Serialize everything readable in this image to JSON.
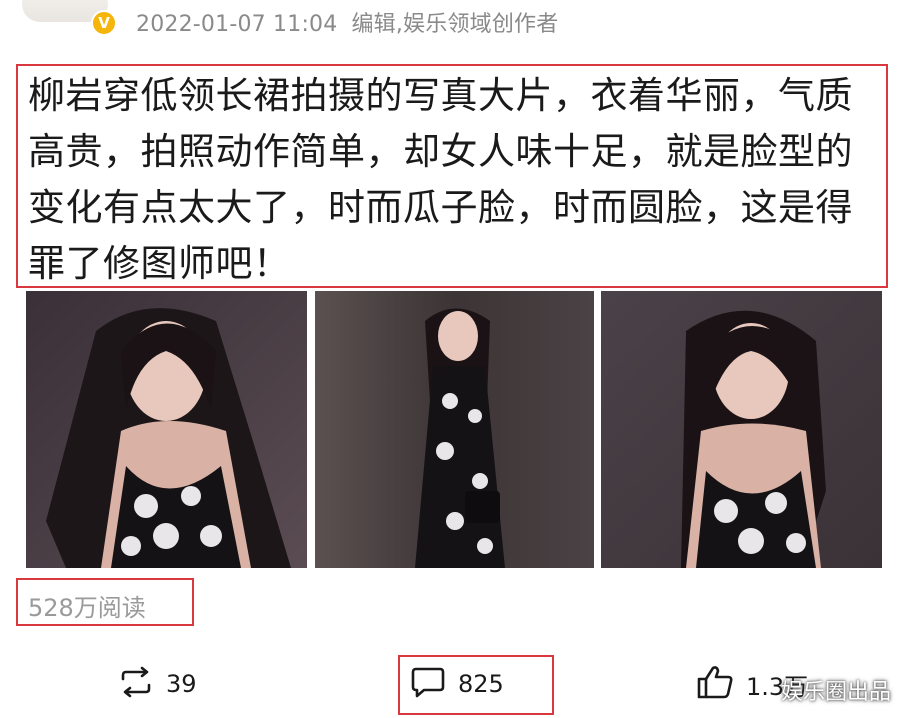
{
  "header": {
    "timestamp": "2022-01-07 11:04",
    "author_role": "编辑,娱乐领域创作者",
    "verified_badge": "V"
  },
  "post": {
    "text": "柳岩穿低领长裙拍摄的写真大片，衣着华丽，气质高贵，拍照动作简单，却女人味十足，就是脸型的变化有点太大了，时而瓜子脸，时而圆脸，这是得罪了修图师吧！"
  },
  "stats": {
    "reads": "528万阅读"
  },
  "actions": {
    "repost_count": "39",
    "comment_count": "825",
    "like_count": "1.3万"
  },
  "watermark": "娱乐圈出品",
  "colors": {
    "highlight_box": "#d9393e",
    "verified_badge": "#f5b50a",
    "meta_text": "#8a8a8a"
  },
  "icons": [
    "repost-icon",
    "comment-icon",
    "like-icon",
    "verified-icon"
  ]
}
